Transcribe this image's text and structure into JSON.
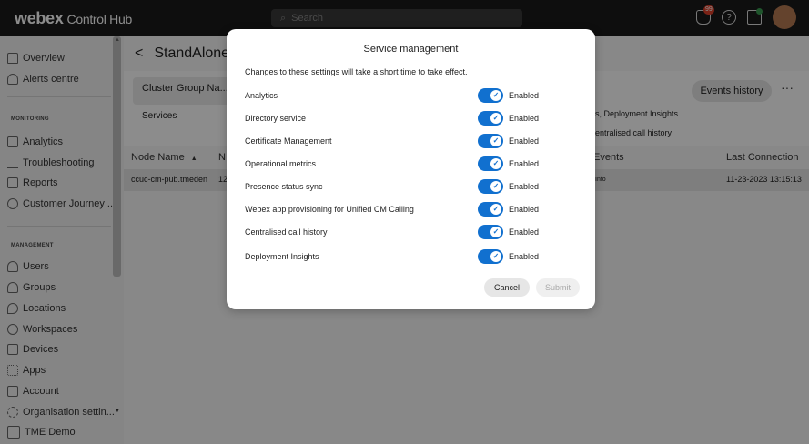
{
  "topbar": {
    "brand": "webex",
    "brand_sub": "Control Hub",
    "search_placeholder": "Search",
    "notification_count": "99"
  },
  "sidebar": {
    "scroll_up_icon": "▲",
    "scroll_down_icon": "▼",
    "items_top": [
      {
        "label": "Overview",
        "icon": "home-icon"
      },
      {
        "label": "Alerts centre",
        "icon": "bell-icon"
      }
    ],
    "monitoring_heading": "MONITORING",
    "monitoring_items": [
      {
        "label": "Analytics",
        "icon": "analytics-icon"
      },
      {
        "label": "Troubleshooting",
        "icon": "pulse-icon"
      },
      {
        "label": "Reports",
        "icon": "report-icon"
      },
      {
        "label": "Customer Journey ...",
        "icon": "journey-icon"
      }
    ],
    "management_heading": "MANAGEMENT",
    "management_items": [
      {
        "label": "Users",
        "icon": "user-icon"
      },
      {
        "label": "Groups",
        "icon": "group-icon"
      },
      {
        "label": "Locations",
        "icon": "location-icon"
      },
      {
        "label": "Workspaces",
        "icon": "workspace-icon"
      },
      {
        "label": "Devices",
        "icon": "device-icon"
      },
      {
        "label": "Apps",
        "icon": "apps-icon"
      },
      {
        "label": "Account",
        "icon": "account-icon"
      },
      {
        "label": "Organisation settin...",
        "icon": "settings-icon"
      },
      {
        "label": "TME Demo",
        "icon": "building-icon"
      }
    ]
  },
  "main": {
    "page_title": "StandAloneCl",
    "cluster_group_label": "Cluster Group Na...",
    "services_label": "Services",
    "right_text1": "s, Deployment Insights",
    "right_text2": "entralised call history",
    "events_history": "Events history",
    "more": "···",
    "table": {
      "headers": {
        "node_name": "Node Name",
        "sort_icon": "▲",
        "col2": "N",
        "events": "Events",
        "last_connection": "Last Connection"
      },
      "row": {
        "node_name": "ccuc-cm-pub.tmeden",
        "col2": "12",
        "events": "Info",
        "last_connection": "11-23-2023 13:15:13"
      }
    }
  },
  "modal": {
    "title": "Service management",
    "description": "Changes to these settings will take a short time to take effect.",
    "services": [
      {
        "name": "Analytics",
        "status": "Enabled",
        "enabled": true
      },
      {
        "name": "Directory service",
        "status": "Enabled",
        "enabled": true
      },
      {
        "name": "Certificate Management",
        "status": "Enabled",
        "enabled": true
      },
      {
        "name": "Operational metrics",
        "status": "Enabled",
        "enabled": true
      },
      {
        "name": "Presence status sync",
        "status": "Enabled",
        "enabled": true
      },
      {
        "name": "Webex app provisioning for Unified CM Calling",
        "status": "Enabled",
        "enabled": true
      },
      {
        "name": "Centralised call history",
        "status": "Enabled",
        "enabled": true
      },
      {
        "name": "Deployment Insights",
        "status": "Enabled",
        "enabled": true
      }
    ],
    "cancel_label": "Cancel",
    "submit_label": "Submit"
  },
  "colors": {
    "toggle_on": "#1170cf",
    "topbar_bg": "#1a1a1a"
  }
}
